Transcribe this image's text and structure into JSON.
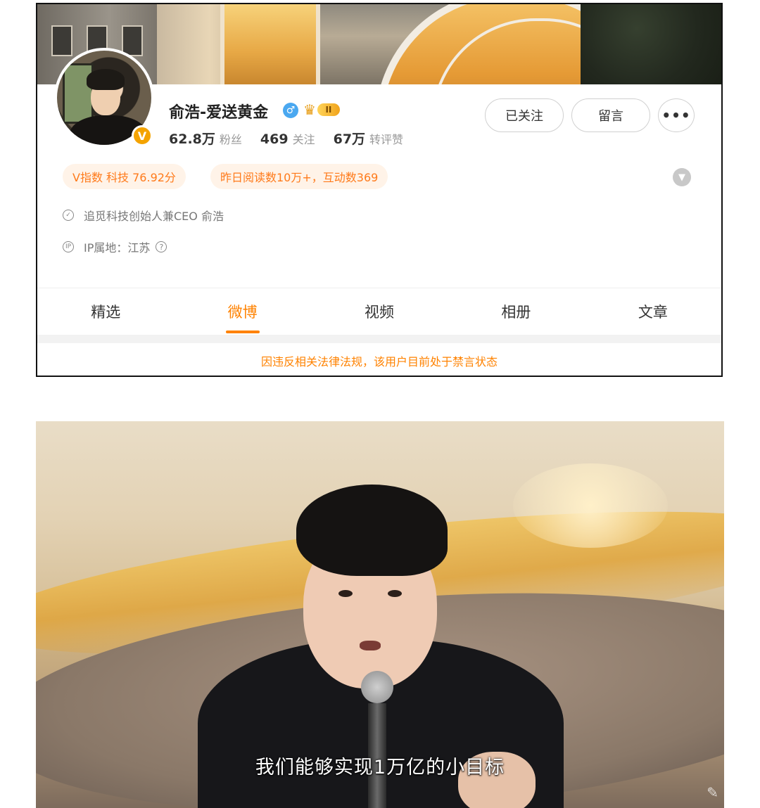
{
  "profile": {
    "name": "俞浩-爱送黄金",
    "gender_icon": "male-icon",
    "vip_level": "II",
    "stats": [
      {
        "num": "62.8万",
        "label": "粉丝"
      },
      {
        "num": "469",
        "label": "关注"
      },
      {
        "num": "67万",
        "label": "转评赞"
      }
    ],
    "buttons": {
      "follow": "已关注",
      "message": "留言",
      "more": "•••"
    },
    "tags": [
      "V指数 科技 76.92分",
      "昨日阅读数10万+，互动数369"
    ],
    "bio": "追觅科技创始人兼CEO 俞浩",
    "ip": "IP属地：江苏",
    "tabs": [
      "精选",
      "微博",
      "视频",
      "相册",
      "文章"
    ],
    "active_tab": "微博",
    "notice": "因违反相关法律法规，该用户目前处于禁言状态",
    "accent_color": "#ff8200"
  },
  "video": {
    "subtitle": "我们能够实现1万亿的小目标"
  }
}
